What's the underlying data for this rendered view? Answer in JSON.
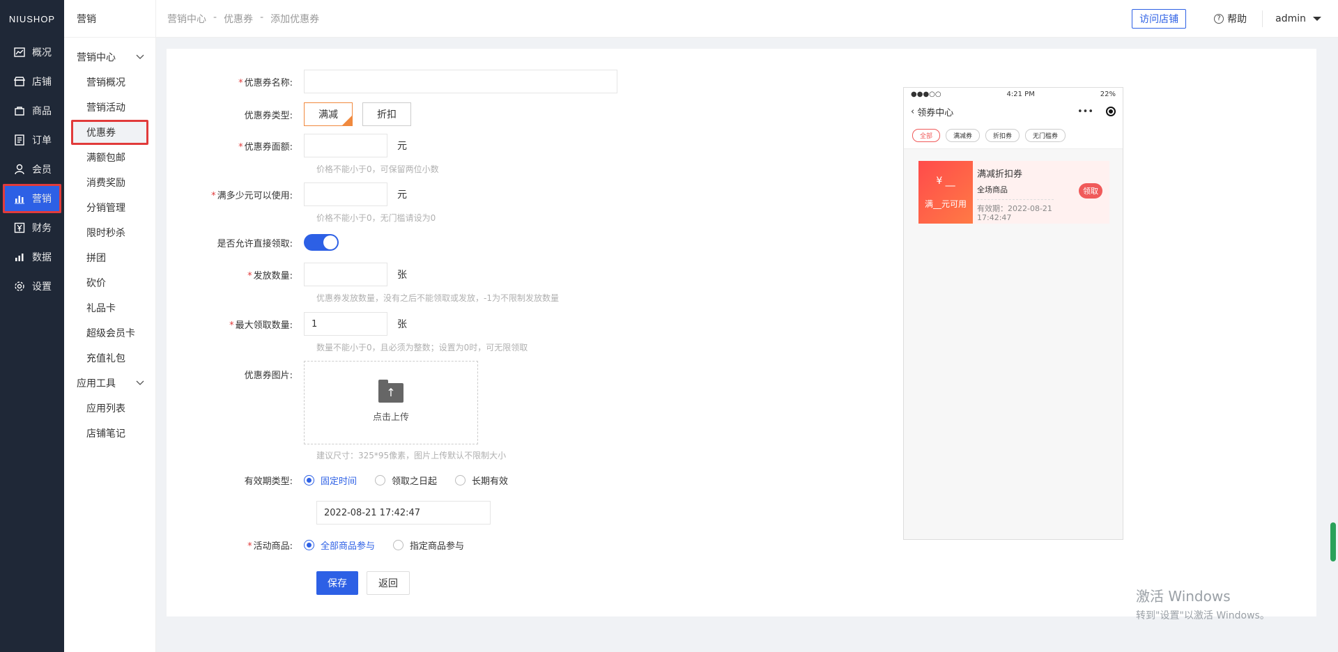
{
  "left_nav": {
    "logo": "NIUSHOP",
    "items": [
      {
        "label": "概况",
        "icon": "chart-icon"
      },
      {
        "label": "店铺",
        "icon": "store-icon"
      },
      {
        "label": "商品",
        "icon": "goods-icon"
      },
      {
        "label": "订单",
        "icon": "order-icon"
      },
      {
        "label": "会员",
        "icon": "user-icon"
      },
      {
        "label": "营销",
        "icon": "bar-chart-icon"
      },
      {
        "label": "财务",
        "icon": "yen-icon"
      },
      {
        "label": "数据",
        "icon": "data-icon"
      },
      {
        "label": "设置",
        "icon": "gear-icon"
      }
    ]
  },
  "sub_nav": {
    "title": "营销",
    "group1": "营销中心",
    "items1": [
      "营销概况",
      "营销活动",
      "优惠券",
      "满额包邮",
      "消费奖励",
      "分销管理",
      "限时秒杀",
      "拼团",
      "砍价",
      "礼品卡",
      "超级会员卡",
      "充值礼包"
    ],
    "group2": "应用工具",
    "items2": [
      "应用列表",
      "店铺笔记"
    ]
  },
  "topbar": {
    "crumb1": "营销中心",
    "sep": "-",
    "crumb2": "优惠券",
    "crumb3": "添加优惠券",
    "visit": "访问店铺",
    "help": "帮助",
    "user": "admin"
  },
  "form": {
    "name_label": "优惠券名称:",
    "type_label": "优惠券类型:",
    "type_opt1": "满减",
    "type_opt2": "折扣",
    "face_label": "优惠券面额:",
    "face_unit": "元",
    "face_hint": "价格不能小于0，可保留两位小数",
    "min_label": "满多少元可以使用:",
    "min_unit": "元",
    "min_hint": "价格不能小于0，无门槛请设为0",
    "direct_label": "是否允许直接领取:",
    "count_label": "发放数量:",
    "count_unit": "张",
    "count_hint": "优惠券发放数量，没有之后不能领取或发放，-1为不限制发放数量",
    "max_label": "最大领取数量:",
    "max_value": "1",
    "max_unit": "张",
    "max_hint": "数量不能小于0，且必须为整数；设置为0时，可无限领取",
    "image_label": "优惠券图片:",
    "upload_text": "点击上传",
    "image_hint": "建议尺寸：325*95像素，图片上传默认不限制大小",
    "validity_label": "有效期类型:",
    "validity_opt1": "固定时间",
    "validity_opt2": "领取之日起",
    "validity_opt3": "长期有效",
    "date_value": "2022-08-21 17:42:47",
    "goods_label": "活动商品:",
    "goods_opt1": "全部商品参与",
    "goods_opt2": "指定商品参与",
    "save": "保存",
    "back": "返回"
  },
  "phone": {
    "signal": "●●●○○",
    "time": "4:21 PM",
    "battery": "22%",
    "title": "领券中心",
    "more": "•••",
    "tabs": [
      "全部",
      "满减券",
      "折扣券",
      "无门槛券"
    ],
    "coupon_money": "¥ __",
    "coupon_cond": "满__元可用",
    "coupon_name": "满减折扣券",
    "coupon_scope": "全场商品",
    "coupon_valid": "有效期：2022-08-21 17:42:47",
    "coupon_btn": "领取"
  },
  "watermark": {
    "line1": "激活 Windows",
    "line2": "转到\"设置\"以激活 Windows。"
  },
  "colors": {
    "primary": "#2d60e5",
    "sidebar": "#1f2837",
    "highlight": "#e13b3b",
    "coupon": "#ff4b4b"
  }
}
